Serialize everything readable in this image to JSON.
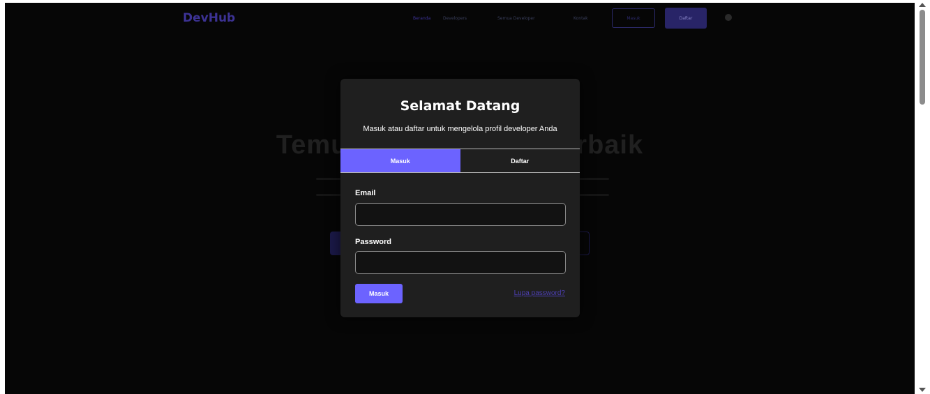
{
  "background": {
    "logo": "DevHub",
    "nav": {
      "links": [
        "Beranda",
        "Developers",
        "Semua Developer",
        "Kontak"
      ],
      "login_label": "Masuk",
      "register_label": "Daftar"
    },
    "hero_title": "Temukan Developer Terbaik"
  },
  "modal": {
    "title": "Selamat Datang",
    "subtitle": "Masuk atau daftar untuk mengelola profil developer Anda",
    "tabs": [
      {
        "label": "Masuk",
        "active": true
      },
      {
        "label": "Daftar",
        "active": false
      }
    ],
    "form": {
      "email_label": "Email",
      "email_value": "",
      "password_label": "Password",
      "password_value": "",
      "submit_label": "Masuk",
      "forgot_label": "Lupa password?"
    }
  },
  "colors": {
    "accent": "#6c63ff",
    "modal_bg": "#1f1f1f",
    "overlay": "#060606",
    "link": "#4c3fb2"
  }
}
